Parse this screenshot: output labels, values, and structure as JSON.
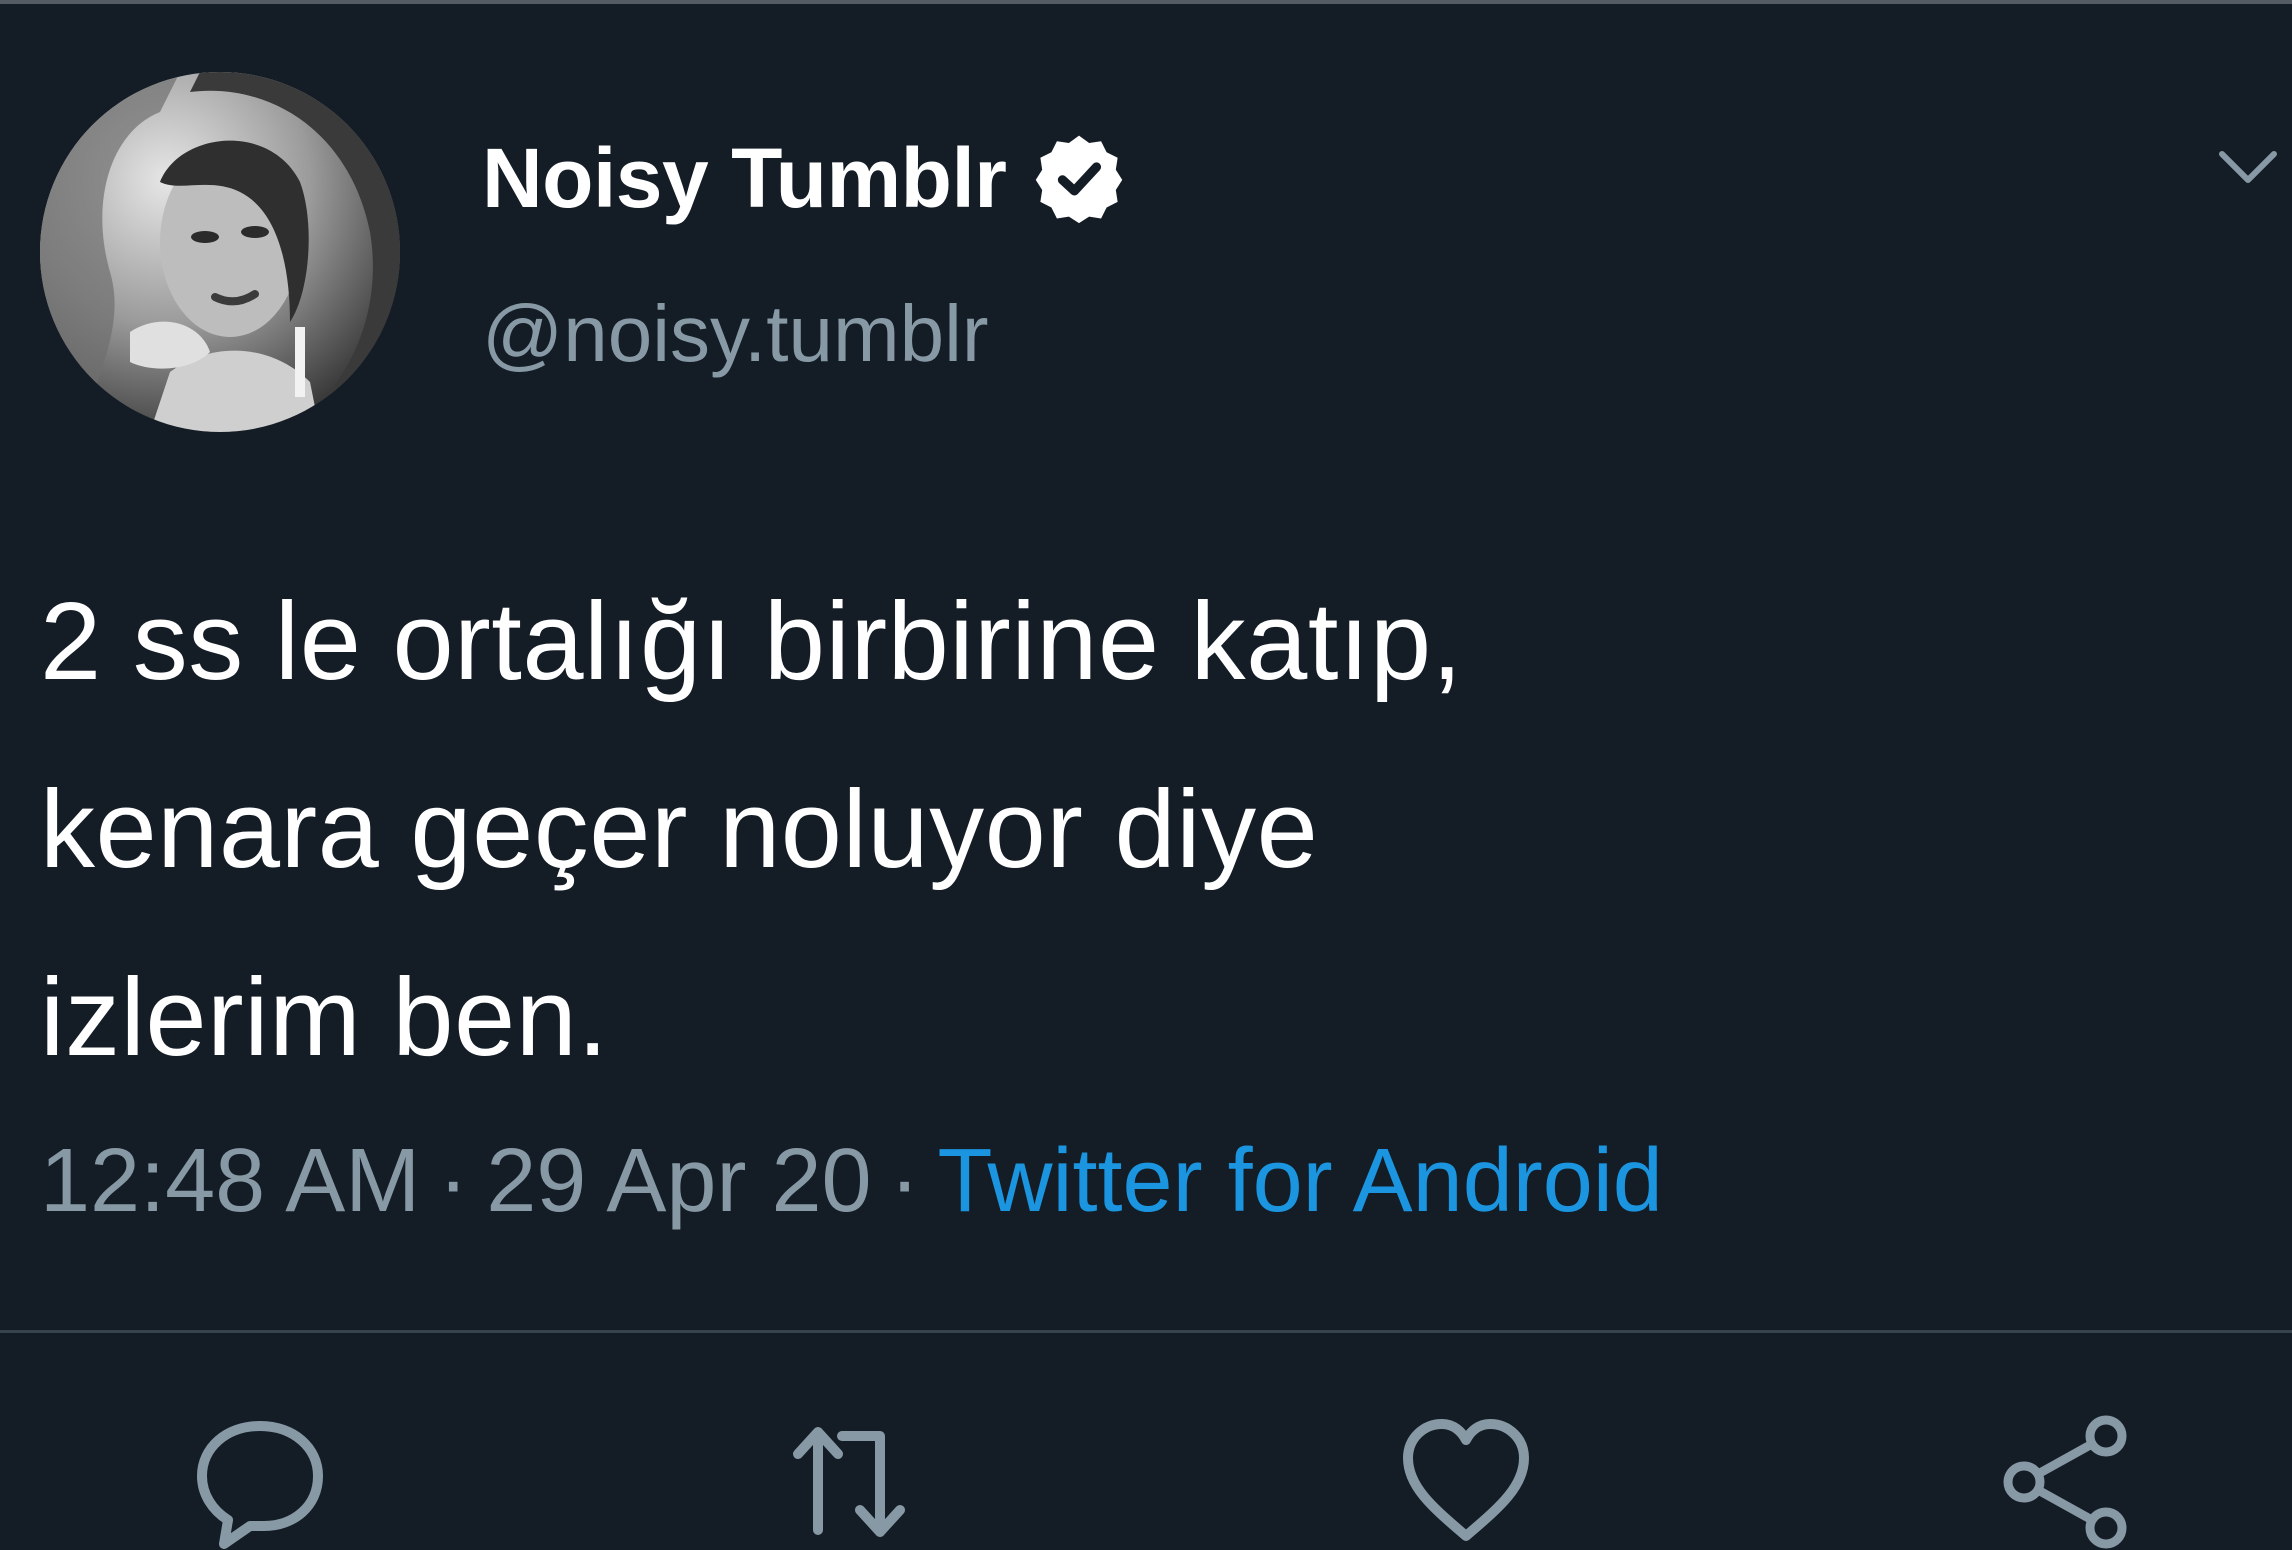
{
  "tweet": {
    "author": {
      "name": "Noisy Tumblr",
      "handle": "@noisy.tumblr",
      "verified": true,
      "avatar_icon": "profile-photo"
    },
    "text_lines": [
      "2 ss le ortalığı birbirine katıp,",
      "kenara geçer noluyor diye",
      "izlerim ben."
    ],
    "meta": {
      "time": "12:48 AM",
      "separator": "·",
      "date": "29 Apr 20",
      "source": "Twitter for Android"
    },
    "menu_icon": "chevron-down-icon",
    "actions": [
      {
        "name": "reply",
        "icon": "reply-icon"
      },
      {
        "name": "retweet",
        "icon": "retweet-icon"
      },
      {
        "name": "like",
        "icon": "heart-icon"
      },
      {
        "name": "share",
        "icon": "share-icon"
      }
    ]
  },
  "colors": {
    "background": "#141d26",
    "text_primary": "#ffffff",
    "text_secondary": "#8899a6",
    "link": "#1b95e0",
    "divider": "#38444d"
  }
}
